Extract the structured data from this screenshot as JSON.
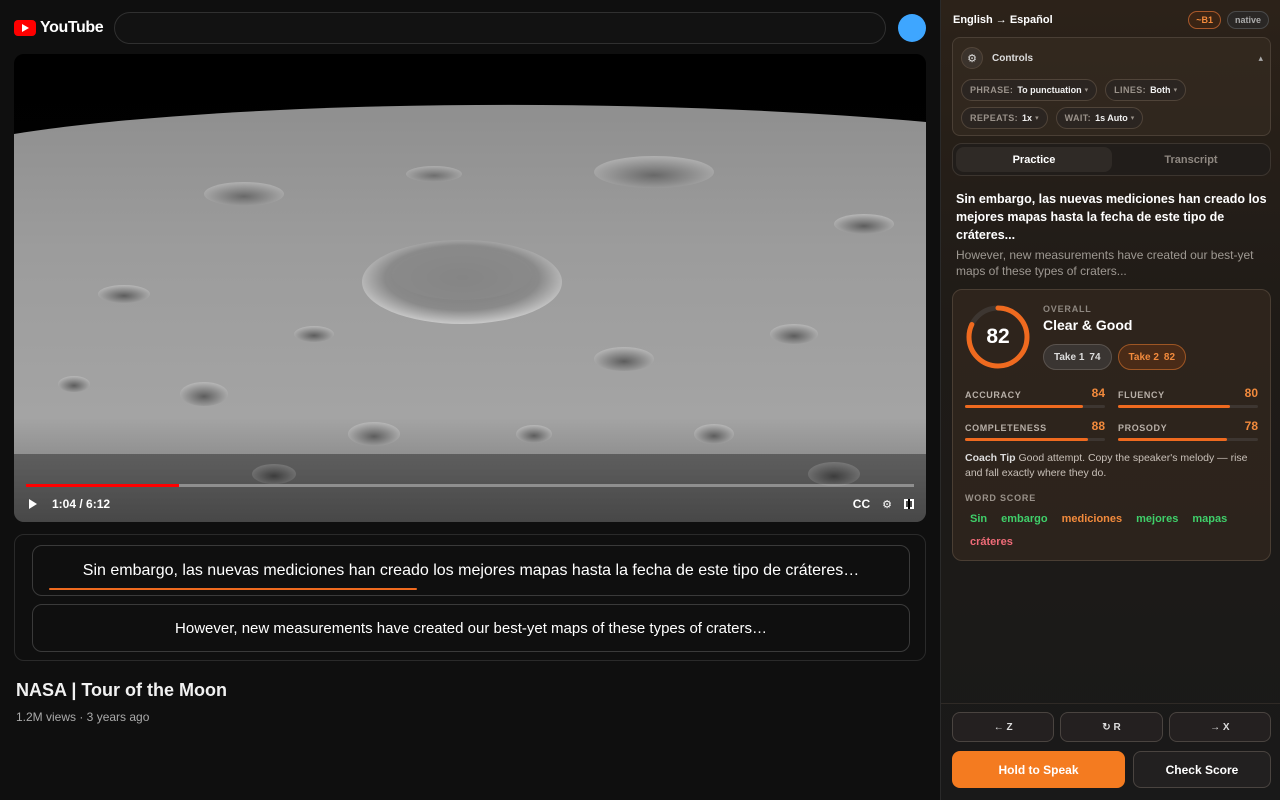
{
  "youtube": {
    "logo_text": "YouTube",
    "search_placeholder": "",
    "player": {
      "time_label": "1:04 / 6:12",
      "progress_fraction": 0.172,
      "cc_label": "CC"
    },
    "captions": {
      "source_line": "Sin embargo, las nuevas mediciones han creado los mejores mapas hasta la fecha de este tipo de cráteres…",
      "translation_line": "However, new measurements have created our best-yet maps of these types of craters…"
    },
    "video": {
      "title": "NASA | Tour of the Moon",
      "meta": "1.2M views · 3 years ago"
    }
  },
  "panel": {
    "language_pair": "English → Español",
    "level_badge": "~B1",
    "native_badge": "native",
    "controls": {
      "label": "Controls",
      "caret": "▴",
      "phrase_key": "PHRASE:",
      "phrase_value": "To punctuation",
      "lines_key": "LINES:",
      "lines_value": "Both",
      "repeats_key": "REPEATS:",
      "repeats_value": "1x",
      "wait_key": "WAIT:",
      "wait_value": "1s Auto"
    },
    "tabs": {
      "practice": "Practice",
      "transcript": "Transcript"
    },
    "phrase": {
      "spanish": "Sin embargo, las nuevas mediciones han creado los mejores mapas hasta la fecha de este tipo de cráteres...",
      "english": "However, new measurements have created our best-yet maps of these types of craters..."
    },
    "score": {
      "overall_value": 82,
      "overall_label": "OVERALL",
      "overall_verdict": "Clear & Good",
      "take1_label": "Take 1",
      "take1_score": "74",
      "take2_label": "Take 2",
      "take2_score": "82",
      "metrics": {
        "accuracy_label": "ACCURACY",
        "accuracy": 84,
        "fluency_label": "FLUENCY",
        "fluency": 80,
        "completeness_label": "COMPLETENESS",
        "completeness": 88,
        "prosody_label": "PROSODY",
        "prosody": 78
      },
      "coach_label": "Coach Tip",
      "coach_text": "Good attempt. Copy the speaker's melody — rise and fall exactly where they do.",
      "word_score_label": "WORD SCORE",
      "words": [
        {
          "text": "Sin",
          "rating": "good"
        },
        {
          "text": "embargo",
          "rating": "good"
        },
        {
          "text": "mediciones",
          "rating": "mid"
        },
        {
          "text": "mejores",
          "rating": "good"
        },
        {
          "text": "mapas",
          "rating": "good"
        },
        {
          "text": "cráteres",
          "rating": "bad"
        }
      ]
    },
    "nav": {
      "prev": "← Z",
      "repeat": "↻ R",
      "next": "→ X"
    },
    "actions": {
      "speak": "Hold to Speak",
      "check": "Check Score"
    }
  },
  "colors": {
    "accent": "#f47b20",
    "youtube_red": "#ff0000",
    "good": "#3fcf6a",
    "mid": "#f28a3c",
    "bad": "#f06b78"
  }
}
